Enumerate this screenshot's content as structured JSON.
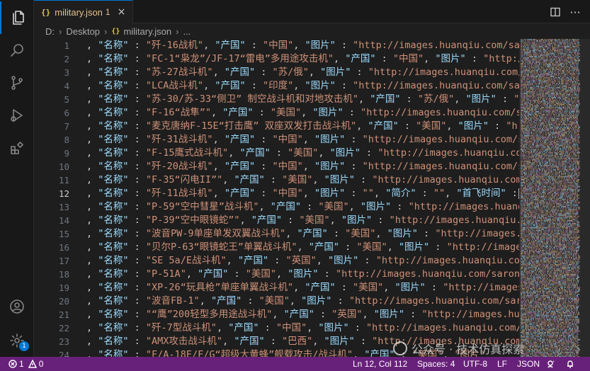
{
  "activity_bar": {
    "items": [
      {
        "icon": "explorer-icon",
        "active": true
      },
      {
        "icon": "search-icon"
      },
      {
        "icon": "source-control-icon"
      },
      {
        "icon": "run-debug-icon"
      },
      {
        "icon": "extensions-icon"
      }
    ],
    "bottom": [
      {
        "icon": "account-icon"
      },
      {
        "icon": "settings-icon",
        "badge": "1"
      }
    ]
  },
  "tab": {
    "file_name": "military.json",
    "problem_count": "1",
    "close_glyph": "×"
  },
  "toolbar": {
    "split_editor_icon": "split-editor-icon",
    "more_actions_label": "···"
  },
  "breadcrumb": {
    "drive": "D:",
    "folder": "Desktop",
    "file": "military.json",
    "trail": "..."
  },
  "editor": {
    "current_line": 12,
    "lines": [
      {
        "num": "1",
        "text": ", \"名称\" : \"歼-16战机\", \"产国\" : \"中国\", \"图片\" : \"http://images.huanqiu.com/saro"
      },
      {
        "num": "2",
        "text": ", \"名称\" : \"FC-1“枭龙”/JF-17“雷电”多用途攻击机\", \"产国\" : \"中国\", \"图片\" : \"http:/"
      },
      {
        "num": "3",
        "text": ", \"名称\" : \"苏-27战斗机\", \"产国\" : \"苏/俄\", \"图片\" : \"http://images.huanqiu.com/s"
      },
      {
        "num": "4",
        "text": ", \"名称\" : \"LCA战斗机\", \"产国\" : \"印度\", \"图片\" : \"http://images.huanqiu.com/saro"
      },
      {
        "num": "5",
        "text": ", \"名称\" : \"苏-30/苏-33“侧卫” 制空战斗机和对地攻击机\", \"产国\" : \"苏/俄\", \"图片\" : \""
      },
      {
        "num": "6",
        "text": ", \"名称\" : \"F-16“战隼”\", \"产国\" : \"美国\", \"图片\" : \"http://images.huanqiu.com/sar"
      },
      {
        "num": "7",
        "text": ", \"名称\" : \"麦克唐纳F-15E“打击鹰” 双座双发打击战斗机\", \"产国\" : \"美国\", \"图片\" : \"h"
      },
      {
        "num": "8",
        "text": ", \"名称\" : \"歼-31战斗机\", \"产国\" : \"中国\", \"图片\" : \"http://images.huanqiu.com/sa"
      },
      {
        "num": "9",
        "text": ", \"名称\" : \"F-15鹰式战斗机\", \"产国\" : \"美国\", \"图片\" : \"http://images.huanqiu.com"
      },
      {
        "num": "10",
        "text": ", \"名称\" : \"歼-20战斗机\", \"产国\" : \"中国\", \"图片\" : \"http://images.huanqiu.com/sa"
      },
      {
        "num": "11",
        "text": ", \"名称\" : \"F-35“闪电II”\", \"产国\" : \"美国\", \"图片\" : \"http://images.huanqiu.com/s"
      },
      {
        "num": "12",
        "text": ", \"名称\" : \"歼-11战斗机\", \"产国\" : \"中国\", \"图片\" : \"\", \"简介\" : \"\", \"首飞时间\" :"
      },
      {
        "num": "13",
        "text": ", \"名称\" : \"P-59“空中彗星”战斗机\", \"产国\" : \"美国\", \"图片\" : \"http://images.huanqi"
      },
      {
        "num": "14",
        "text": ", \"名称\" : \"P-39“空中眼镜蛇”\", \"产国\" : \"美国\", \"图片\" : \"http://images.huanqiu.c"
      },
      {
        "num": "15",
        "text": ", \"名称\" : \"波音PW-9单座单发双翼战斗机\", \"产国\" : \"美国\", \"图片\" : \"http://images.h"
      },
      {
        "num": "16",
        "text": ", \"名称\" : \"贝尔P-63“眼镜蛇王”单翼战斗机\", \"产国\" : \"美国\", \"图片\" : \"http://image"
      },
      {
        "num": "17",
        "text": ", \"名称\" : \"SE 5a/E战斗机\", \"产国\" : \"英国\", \"图片\" : \"http://images.huanqiu.com/"
      },
      {
        "num": "18",
        "text": ", \"名称\" : \"P-51A\", \"产国\" : \"美国\", \"图片\" : \"http://images.huanqiu.com/sarons/2"
      },
      {
        "num": "19",
        "text": ", \"名称\" : \"XP-26“玩具枪”单座单翼战斗机\", \"产国\" : \"美国\", \"图片\" : \"http://images"
      },
      {
        "num": "20",
        "text": ", \"名称\" : \"波音FB-1\", \"产国\" : \"美国\", \"图片\" : \"http://images.huanqiu.com/saron"
      },
      {
        "num": "21",
        "text": ", \"名称\" : \"“鹰”200轻型多用途战斗机\", \"产国\" : \"英国\", \"图片\" : \"http://images.hua"
      },
      {
        "num": "22",
        "text": ", \"名称\" : \"歼-7型战斗机\", \"产国\" : \"中国\", \"图片\" : \"http://images.huanqiu.com/s"
      },
      {
        "num": "23",
        "text": ", \"名称\" : \"AMX攻击战斗机\", \"产国\" : \"巴西\", \"图片\" : \"http://images.huanqiu.com/"
      },
      {
        "num": "24",
        "text": ", \"名称\" : \"F/A-18E/F/G“超级大黄蜂”舰载攻击/战斗机\", \"产国\" : \"美国\", \"图片\""
      }
    ]
  },
  "statusbar": {
    "errors": "1",
    "warnings": "0",
    "position": "Ln 12, Col 112",
    "spaces": "Spaces: 4",
    "encoding": "UTF-8",
    "eol": "LF",
    "language": "JSON",
    "feedback_icon": "feedback-icon",
    "bell_icon": "bell-icon",
    "color": "#68217a"
  },
  "watermark": {
    "text": "公众号 · 技术仿真探索"
  }
}
